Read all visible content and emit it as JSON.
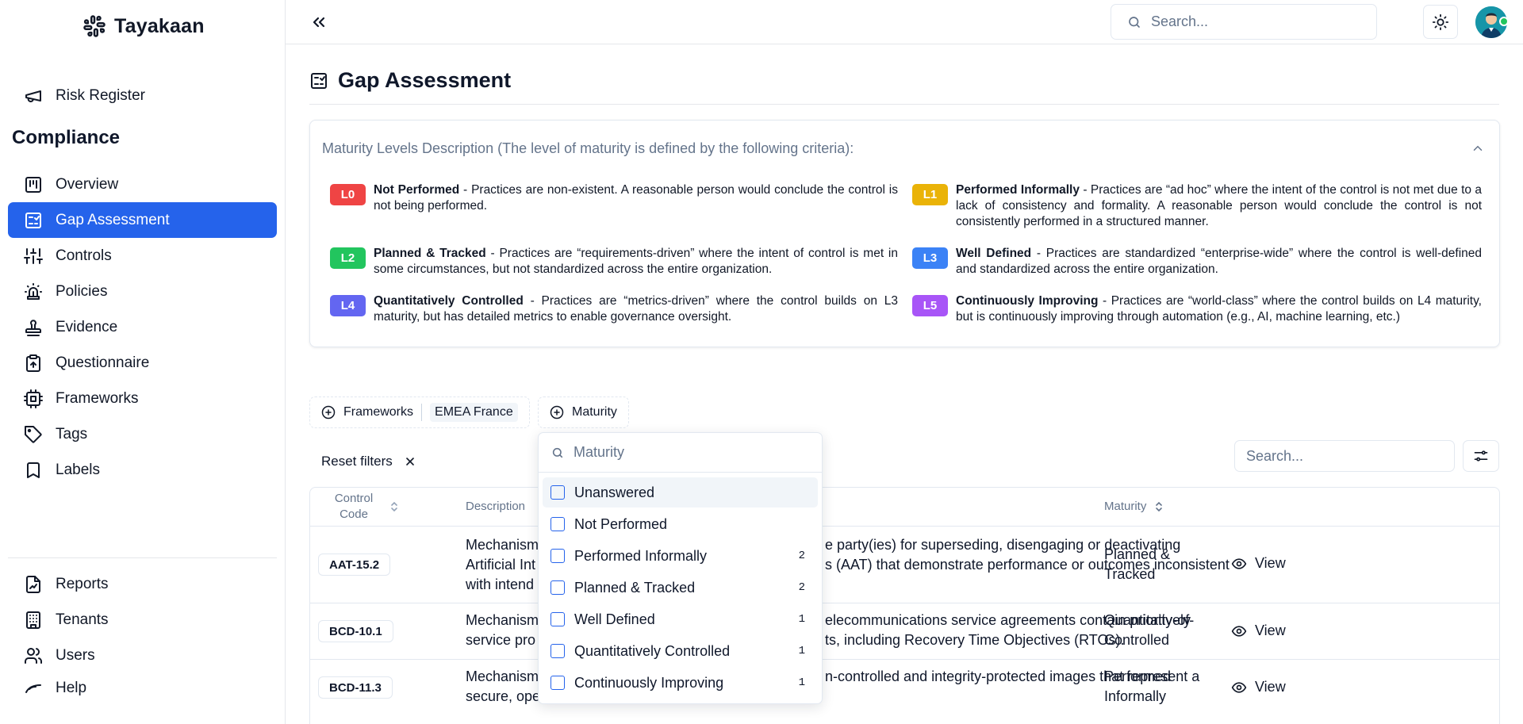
{
  "app": {
    "name": "Tayakaan"
  },
  "sidebar": {
    "top_items": [
      {
        "label": "Risk Register",
        "icon": "megaphone-icon"
      }
    ],
    "section_title": "Compliance",
    "items": [
      {
        "label": "Overview",
        "icon": "overview-icon"
      },
      {
        "label": "Gap Assessment",
        "icon": "gap-assessment-icon",
        "active": true
      },
      {
        "label": "Controls",
        "icon": "sliders-icon"
      },
      {
        "label": "Policies",
        "icon": "siren-icon"
      },
      {
        "label": "Evidence",
        "icon": "stamp-icon"
      },
      {
        "label": "Questionnaire",
        "icon": "clipboard-icon"
      },
      {
        "label": "Frameworks",
        "icon": "cpu-icon"
      },
      {
        "label": "Tags",
        "icon": "tag-icon"
      },
      {
        "label": "Labels",
        "icon": "bookmark-icon"
      }
    ],
    "bottom_items": [
      {
        "label": "Reports",
        "icon": "file-chart-icon"
      },
      {
        "label": "Tenants",
        "icon": "building-icon"
      },
      {
        "label": "Users",
        "icon": "users-icon"
      },
      {
        "label": "Help",
        "icon": "help-icon"
      }
    ]
  },
  "topbar": {
    "search_placeholder": "Search..."
  },
  "page": {
    "title": "Gap Assessment"
  },
  "maturity_card": {
    "heading": "Maturity Levels Description (The level of maturity is defined by the following criteria):",
    "levels": [
      {
        "code": "L0",
        "color": "#ef4444",
        "name": "Not Performed",
        "text": " - Practices are non-existent. A reasonable person would conclude the control is not being performed."
      },
      {
        "code": "L1",
        "color": "#eab308",
        "name": "Performed Informally",
        "text": " - Practices are “ad hoc” where the intent of the control is not met due to a lack of consistency and formality. A reasonable person would conclude the control is not consistently performed in a structured manner."
      },
      {
        "code": "L2",
        "color": "#22c55e",
        "name": "Planned & Tracked",
        "text": " - Practices are “requirements-driven” where the intent of control is met in some circumstances, but not standardized across the entire organization."
      },
      {
        "code": "L3",
        "color": "#3b82f6",
        "name": "Well Defined",
        "text": " - Practices are standardized “enterprise-wide” where the control is well-defined and standardized across the entire organization."
      },
      {
        "code": "L4",
        "color": "#6366f1",
        "name": "Quantitatively Controlled",
        "text": " - Practices are “metrics-driven” where the control builds on L3 maturity, but has detailed metrics to enable governance oversight."
      },
      {
        "code": "L5",
        "color": "#a855f7",
        "name": "Continuously Improving",
        "text": " - Practices are “world-class” where the control builds on L4 maturity, but is continuously improving through automation (e.g., AI, machine learning, etc.)"
      }
    ]
  },
  "filters": {
    "frameworks_label": "Frameworks",
    "frameworks_value": "EMEA France",
    "maturity_label": "Maturity",
    "reset_label": "Reset filters",
    "table_search_placeholder": "Search..."
  },
  "table": {
    "headers": {
      "code": "Control Code",
      "description": "Description",
      "maturity": "Maturity"
    },
    "view_label": "View",
    "rows": [
      {
        "code": "AAT-15.2",
        "desc_left_1": "Mechanism",
        "desc_left_2": "Artificial Int",
        "desc_left_3": "with intend",
        "desc_right_1": "e party(ies) for superseding, disengaging or deactivating",
        "desc_right_2": "s (AAT) that demonstrate performance or outcomes inconsistent",
        "maturity": "Planned & Tracked"
      },
      {
        "code": "BCD-10.1",
        "desc_left_1": "Mechanism",
        "desc_left_2": "service pro",
        "desc_right_1": "elecommunications service agreements contain priority-of-",
        "desc_right_2": "ts, including Recovery Time Objectives (RTOs).",
        "maturity": "Quantitatively Controlled"
      },
      {
        "code": "BCD-11.3",
        "desc_left_1": "Mechanism",
        "desc_left_2": "secure, ope",
        "desc_right_1": "n-controlled and integrity-protected images that represent a",
        "maturity": "Performed Informally"
      }
    ]
  },
  "maturity_dropdown": {
    "placeholder": "Maturity",
    "options": [
      {
        "label": "Unanswered",
        "count": ""
      },
      {
        "label": "Not Performed",
        "count": ""
      },
      {
        "label": "Performed Informally",
        "count": "2"
      },
      {
        "label": "Planned & Tracked",
        "count": "2"
      },
      {
        "label": "Well Defined",
        "count": "1"
      },
      {
        "label": "Quantitatively Controlled",
        "count": "1"
      },
      {
        "label": "Continuously Improving",
        "count": "1"
      }
    ]
  }
}
